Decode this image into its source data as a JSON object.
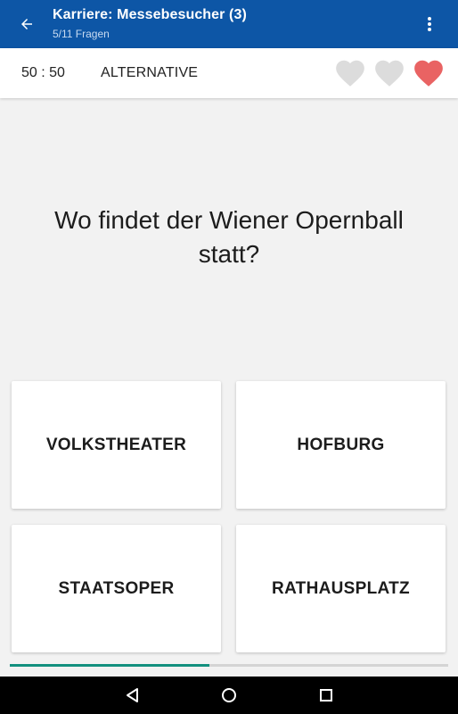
{
  "appbar": {
    "title": "Karriere: Messebesucher (3)",
    "subtitle": "5/11 Fragen",
    "color": "#0d56a6"
  },
  "jokers": {
    "fifty_fifty": "50 : 50",
    "alternative": "ALTERNATIVE"
  },
  "lives": {
    "total": 3,
    "remaining": 1,
    "active_color": "#e96363",
    "lost_color": "#dcdcdc"
  },
  "question": "Wo findet der Wiener Opernball statt?",
  "answers": [
    "VOLKSTHEATER",
    "HOFBURG",
    "STAATSOPER",
    "RATHAUSPLATZ"
  ],
  "progress": {
    "fraction": 0.455,
    "color": "#13907e"
  },
  "icons": {
    "back": "arrow-left-icon",
    "menu": "more-vert-icon",
    "heart": "heart-icon",
    "nav_back": "triangle-back-icon",
    "nav_home": "circle-home-icon",
    "nav_recents": "square-recents-icon"
  }
}
